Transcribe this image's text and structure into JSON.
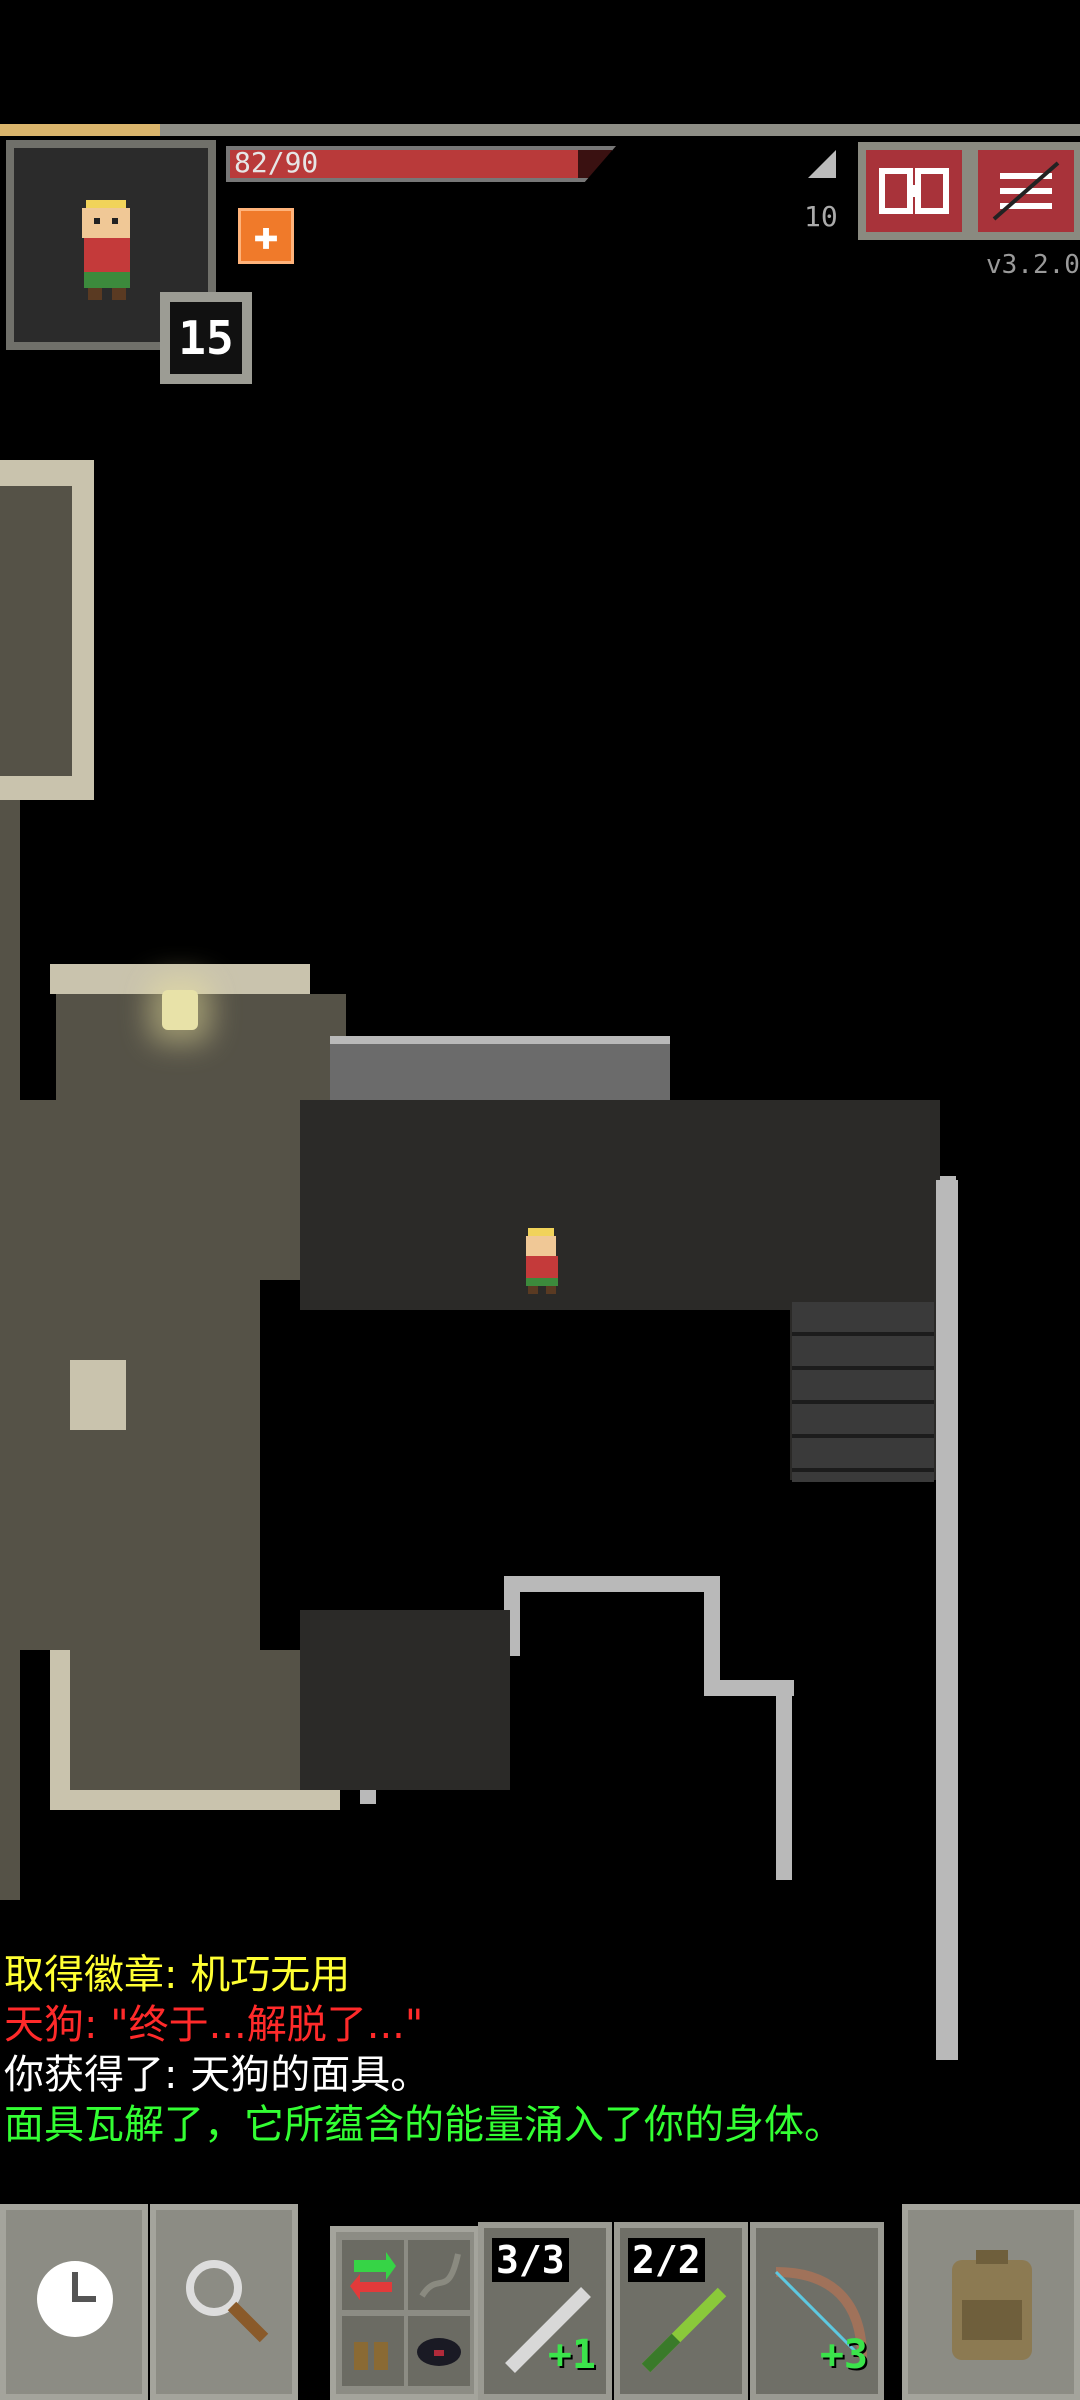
{
  "hud": {
    "hp_text": "82/90",
    "hp_fraction": 0.911,
    "hero_level": "15",
    "depth": "10",
    "version": "v3.2.0",
    "buff_icon": "plus-buff-icon",
    "journal_icon": "journal-icon",
    "menu_icon": "menu-icon"
  },
  "log": {
    "lines": [
      {
        "text": "取得徽章: 机巧无用",
        "color": "#ffff33"
      },
      {
        "text": "天狗: \"终于...解脱了...\"",
        "color": "#ff2a2a"
      },
      {
        "text": "你获得了: 天狗的面具。",
        "color": "#ffffff"
      },
      {
        "text": "面具瓦解了，它所蕴含的能量涌入了你的身体。",
        "color": "#33ff33"
      }
    ]
  },
  "toolbar": {
    "wait_icon": "clock-icon",
    "search_icon": "magnifier-icon",
    "backpack_icon": "backpack-icon",
    "quickslots": [
      {
        "count": "3/3",
        "bonus": "+1",
        "icon": "sword-icon"
      },
      {
        "count": "2/2",
        "bonus": "",
        "icon": "wand-icon"
      },
      {
        "count": "",
        "bonus": "+3",
        "icon": "bow-icon"
      }
    ]
  },
  "colors": {
    "hp": "#b93a3a",
    "log_badge": "#ffff33",
    "log_boss": "#ff2a2a",
    "log_item": "#ffffff",
    "log_positive": "#33ff33"
  }
}
